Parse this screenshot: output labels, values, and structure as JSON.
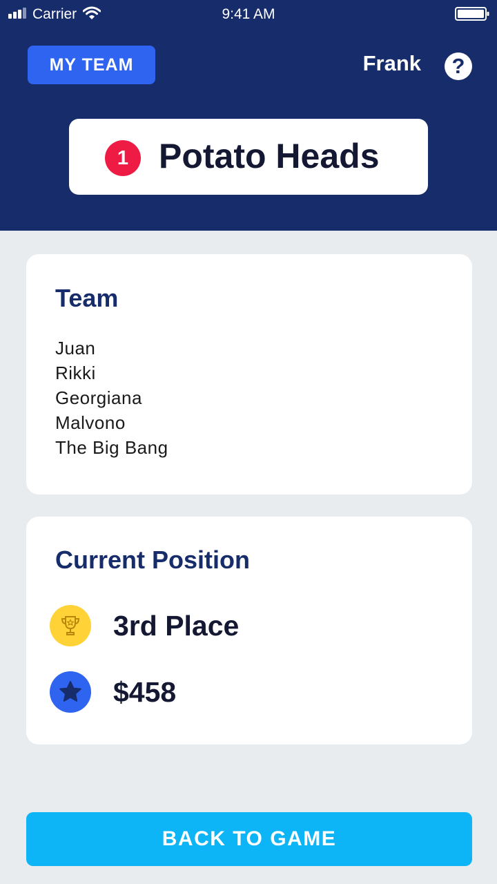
{
  "status_bar": {
    "carrier": "Carrier",
    "time": "9:41 AM",
    "signal_icon": "signal-icon",
    "wifi_icon": "wifi-icon",
    "battery_icon": "battery-icon"
  },
  "header": {
    "my_team_label": "MY TEAM",
    "username": "Frank",
    "help_icon": "help-icon",
    "help_glyph": "?",
    "team_rank": "1",
    "team_name": "Potato Heads"
  },
  "team_card": {
    "title": "Team",
    "members": [
      "Juan",
      "Rikki",
      "Georgiana",
      "Malvono",
      "The Big Bang"
    ]
  },
  "position_card": {
    "title": "Current Position",
    "place": "3rd Place",
    "place_icon": "trophy-icon",
    "winnings": "$458",
    "winnings_icon": "star-icon"
  },
  "footer": {
    "back_label": "BACK TO GAME"
  },
  "colors": {
    "header_bg": "#172D6B",
    "accent_blue": "#2E64F0",
    "rank_red": "#EE1C45",
    "trophy_yellow": "#FFD338",
    "action_cyan": "#0DB5F7",
    "page_bg": "#E8ECEE"
  }
}
